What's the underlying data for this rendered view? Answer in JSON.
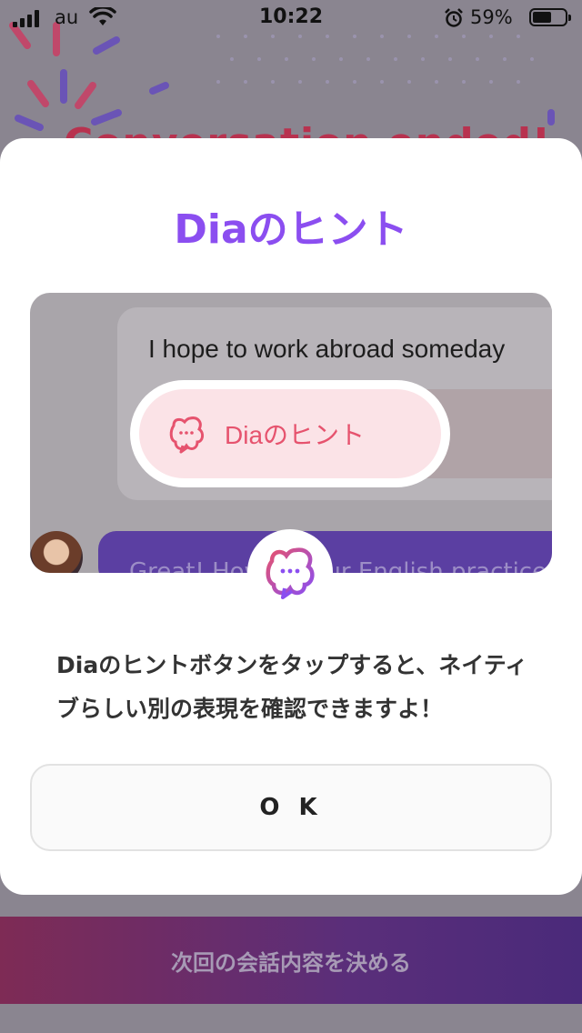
{
  "status_bar": {
    "carrier": "au",
    "time": "10:22",
    "battery_percent": "59%",
    "battery_level": 0.59,
    "icons": [
      "signal-icon",
      "wifi-icon",
      "alarm-icon",
      "battery-icon"
    ]
  },
  "background": {
    "title": "Conversation ended!",
    "cta_label": "次回の会話内容を決める"
  },
  "modal": {
    "title": "Diaのヒント",
    "preview": {
      "message_text": "I hope to work abroad someday",
      "hint_button_label": "Diaのヒント",
      "ai_message_text": "Great! How is your English practice"
    },
    "description": "Diaのヒントボタンをタップすると、ネイティブらしい別の表現を確認できますよ！",
    "ok_label": "O K"
  },
  "colors": {
    "accent_purple": "#8b4ef0",
    "hint_pink": "#e6536e",
    "hint_pill_bg": "#fbe3e7"
  }
}
